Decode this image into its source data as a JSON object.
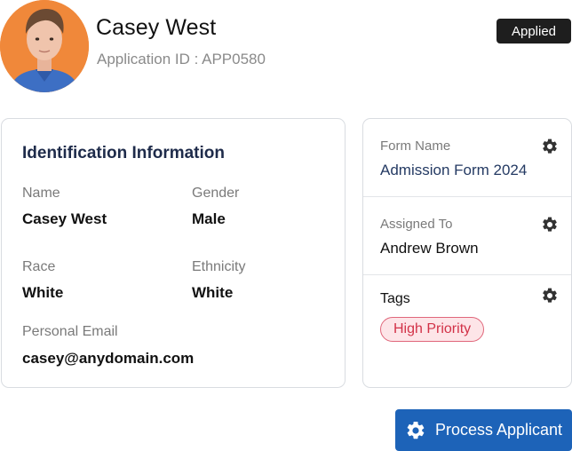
{
  "applicant": {
    "name": "Casey West",
    "application_id": "Application ID : APP0580",
    "status": "Applied"
  },
  "identification": {
    "title": "Identification Information",
    "fields": [
      {
        "label": "Name",
        "value": "Casey West"
      },
      {
        "label": "Gender",
        "value": "Male"
      },
      {
        "label": "Race",
        "value": "White"
      },
      {
        "label": "Ethnicity",
        "value": "White"
      },
      {
        "label": "Personal Email",
        "value": "casey@anydomain.com"
      }
    ]
  },
  "sidebar": {
    "form_name": {
      "label": "Form Name",
      "value": "Admission Form 2024"
    },
    "assigned_to": {
      "label": "Assigned To",
      "value": "Andrew Brown"
    },
    "tags": {
      "label": "Tags",
      "items": [
        "High Priority"
      ]
    }
  },
  "actions": {
    "process_label": "Process Applicant"
  },
  "colors": {
    "primary_button": "#1d63b8",
    "status_badge": "#1e1e1e",
    "tag_bg": "#fde5e8",
    "tag_text": "#d23248",
    "section_title": "#1e2b4a",
    "avatar_bg": "#f0883a"
  },
  "icons": {
    "settings": "gear-icon"
  }
}
